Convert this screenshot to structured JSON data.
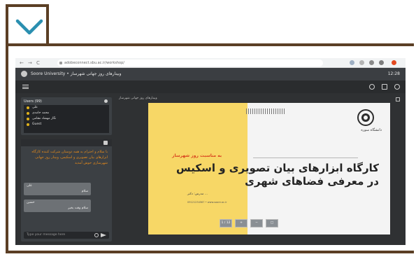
{
  "decor": {
    "chevron_icon": "chevron-down-icon",
    "frame_color": "#5b3f25"
  },
  "browser": {
    "back": "←",
    "forward": "→",
    "reload": "C",
    "url": "adobeconnect.sbu.ac.ir/workshop/"
  },
  "app": {
    "title": "Soore University • وبینارهای روز جهانی شهرساز",
    "time": "12:28"
  },
  "presentation": {
    "label": "وبینارهای روز جهانی شهرساز"
  },
  "users_panel": {
    "title": "Users (99)",
    "users": [
      "علی",
      "محمد حامدی",
      "نگار مهشاد مقامی",
      "Guest"
    ]
  },
  "chat_panel": {
    "message": "با سلام و احترام به همه دوستان شرکت کننده کارگاه ابزارهای بیان تصویری و اسکیس، وبینار روز جهانی شهرسازی خوش آمدید",
    "bubble1": {
      "name": "علی",
      "text": "سلام"
    },
    "bubble2": {
      "name": "حسین",
      "text": "سلام وقت بخیر"
    },
    "input_placeholder": "Type your message here"
  },
  "slide": {
    "occasion": "به مناسبت روز شهرساز",
    "headline": "کارگاه ابزارهای بیان تصویری و اسکیس در معرفی فضاهای شهری",
    "university": "دانشگاه سوره",
    "presenter": "مدرس: دکتر ...",
    "contacts": "09121234567 • www.soore.ac.ir"
  },
  "controls": {
    "page": "1 / 12",
    "zoom_in": "+",
    "zoom_out": "−",
    "fit": "□"
  }
}
